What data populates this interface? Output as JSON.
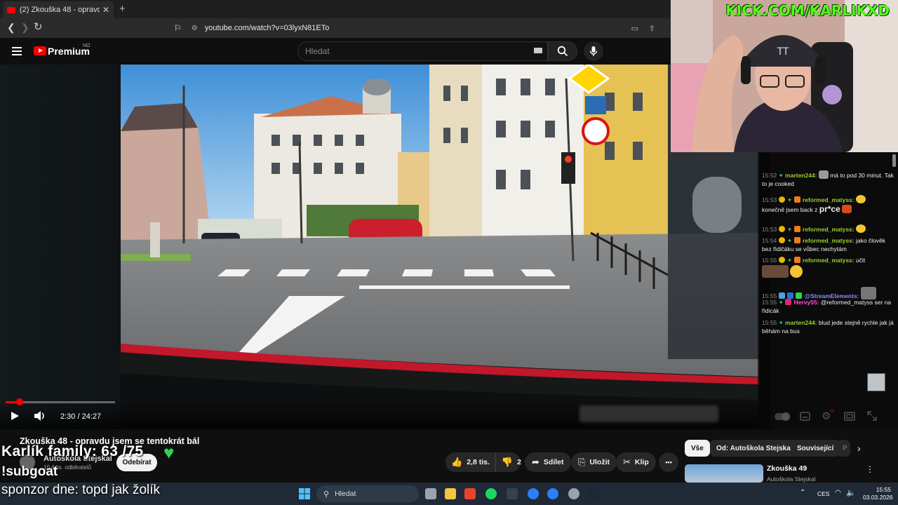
{
  "browser": {
    "tab_title": "(2) Zkouška 48 - opravdu jsem se tentokrát bál",
    "tab_close": "✕",
    "new_tab": "+",
    "url": "youtube.com/watch?v=03lyxN81ETo"
  },
  "youtube": {
    "logo_text": "Premium",
    "country_code": "NO",
    "search_placeholder": "Hledat"
  },
  "player": {
    "current_time": "2:30",
    "duration": "24:27",
    "time_display": "2:30 / 24:27",
    "progress_fraction": 0.102
  },
  "stream_overlay": {
    "kick_url": "KICK.COM/KARLIKXD",
    "family_counter": "Karlík family: 63 /75",
    "subgoat": "!subgoat",
    "sponsor": "sponzor dne: topd jak žolík"
  },
  "chat": {
    "messages": [
      {
        "time": "15:52",
        "user": "marten244:",
        "text": "má to pod 30 minut. Tak to je cooked",
        "color": "#9acd32"
      },
      {
        "time": "15:53",
        "user": "reformed_matyss:",
        "text": "konečně jsem back z",
        "extra": "pr*ce",
        "color": "#9acd32"
      },
      {
        "time": "15:53",
        "user": "reformed_matyss:",
        "text": "",
        "color": "#9acd32"
      },
      {
        "time": "15:54",
        "user": "reformed_matyss:",
        "text": "jako člověk bez řidičáku se vůbec nechytám",
        "color": "#9acd32"
      },
      {
        "time": "15:55",
        "user": "reformed_matyss:",
        "text": "učit",
        "color": "#9acd32"
      },
      {
        "time": "15:55",
        "user": "@StreamElements:",
        "text": "",
        "color": "#8b8bff"
      },
      {
        "time": "15:55",
        "user": "Hervy55:",
        "text": "@reformed_matyss ser na řidicák",
        "color": "#ff4fd8"
      },
      {
        "time": "15:55",
        "user": "marten244:",
        "text": "blud jede stejně rychle jak já běhám na bus",
        "color": "#9acd32"
      }
    ]
  },
  "video_info": {
    "title": "Zkouška 48 - opravdu jsem se tentokrát bál",
    "channel": "Autoškola Stejskal",
    "subscribers": "10,4 tis. odběratelů",
    "unsubscribe_label": "Odebírat",
    "like_count": "2,8 tis.",
    "dislike_count": "2",
    "share_label": "Sdílet",
    "save_label": "Uložit",
    "clip_label": "Klip",
    "more_label": "•••"
  },
  "recommendations": {
    "chips": [
      "Vše",
      "Od: Autoškola Stejskal",
      "Související",
      "P"
    ],
    "next_title": "Zkouška 49",
    "next_channel": "Autoškola Stejskal"
  },
  "taskbar": {
    "search_placeholder": "Hledat",
    "language": "CES",
    "time": "15:55",
    "date": "03.03.2026"
  }
}
